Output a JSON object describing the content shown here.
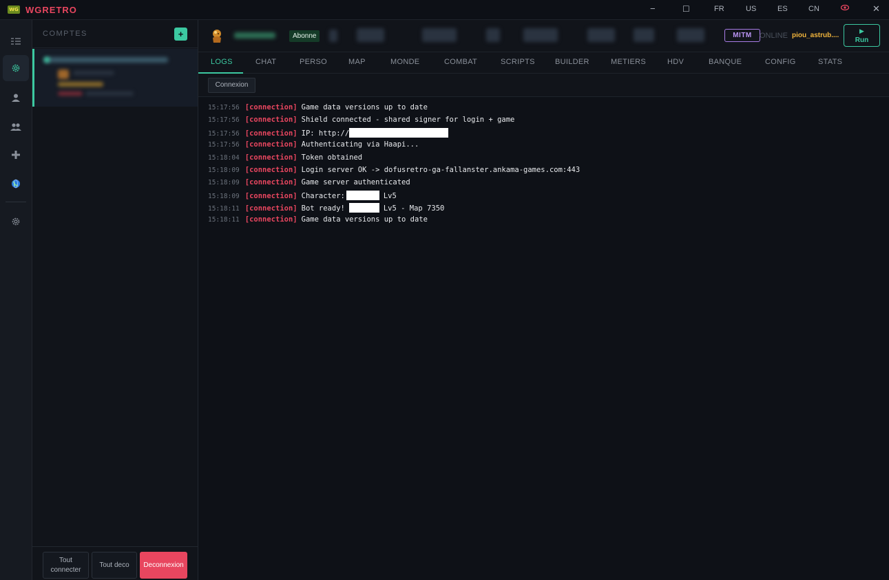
{
  "app": {
    "title": "WGRETRO",
    "logo_text": "WG"
  },
  "titlebar": {
    "lang_fr": "FR",
    "lang_us": "US",
    "lang_es": "ES",
    "lang_cn": "CN",
    "minimize_icon": "−",
    "maximize_icon": "☐",
    "eye_icon": "👁",
    "close_icon": "✕"
  },
  "rail": {
    "items": [
      {
        "icon": "list-icon",
        "glyph": "☷"
      },
      {
        "icon": "gear-icon",
        "glyph": "⚙"
      },
      {
        "icon": "user-icon",
        "glyph": "👤"
      },
      {
        "icon": "users-icon",
        "glyph": "👥"
      },
      {
        "icon": "plus-icon",
        "glyph": "✚"
      },
      {
        "icon": "globe-icon",
        "glyph": "🌐"
      },
      {
        "icon": "settings-icon",
        "glyph": "⚙"
      }
    ]
  },
  "accounts": {
    "title": "COMPTES",
    "add_label": "+",
    "connect_all_label": "Tout connecter",
    "disconnect_all_label": "Tout deco",
    "logout_label": "Deconnexion"
  },
  "header": {
    "subscription_badge": "Abonne",
    "mitm_badge": "MITM",
    "status": "ONLINE",
    "username": "piou_astrub....",
    "run_label": "Run",
    "run_icon": "▶"
  },
  "tabs": [
    {
      "label": "LOGS",
      "active": true
    },
    {
      "label": "CHAT"
    },
    {
      "label": "PERSO"
    },
    {
      "label": "MAP"
    },
    {
      "label": "MONDE"
    },
    {
      "label": "COMBAT"
    },
    {
      "label": "SCRIPTS"
    },
    {
      "label": "BUILDER"
    },
    {
      "label": "METIERS"
    },
    {
      "label": "HDV"
    },
    {
      "label": "BANQUE"
    },
    {
      "label": "CONFIG"
    },
    {
      "label": "STATS"
    }
  ],
  "filter": {
    "chip_label": "Connexion"
  },
  "logs": [
    {
      "time": "15:17:56",
      "tag": "[connection]",
      "msg": "Game data versions up to date"
    },
    {
      "time": "15:17:56",
      "tag": "[connection]",
      "msg": "Shield connected - shared signer for login + game"
    },
    {
      "time": "15:17:56",
      "tag": "[connection]",
      "msg": "IP: http://",
      "msg_after": ""
    },
    {
      "time": "15:17:56",
      "tag": "[connection]",
      "msg": "Authenticating via Haapi..."
    },
    {
      "time": "15:18:04",
      "tag": "[connection]",
      "msg": "Token obtained"
    },
    {
      "time": "15:18:09",
      "tag": "[connection]",
      "msg": "Login server OK -> dofusretro-ga-fallanster.ankama-games.com:443"
    },
    {
      "time": "15:18:09",
      "tag": "[connection]",
      "msg": "Game server authenticated"
    },
    {
      "time": "15:18:09",
      "tag": "[connection]",
      "msg": "Character:",
      "msg_after": "Lv5"
    },
    {
      "time": "15:18:11",
      "tag": "[connection]",
      "msg": "Bot ready!",
      "msg_after": "Lv5 - Map 7350"
    },
    {
      "time": "15:18:11",
      "tag": "[connection]",
      "msg": "Game data versions up to date"
    }
  ],
  "colors": {
    "accent": "#3cc9a1",
    "danger": "#e8465f",
    "mitm": "#b994f2",
    "username": "#f2b53c"
  }
}
